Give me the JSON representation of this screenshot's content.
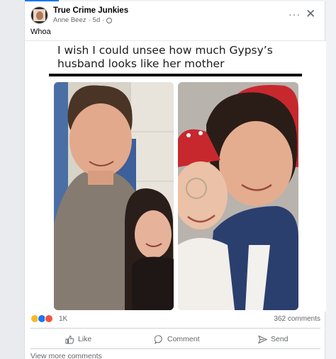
{
  "post": {
    "group_name": "True Crime Junkies",
    "author": "Anne Beez",
    "time": "5d",
    "separator": "·",
    "text": "Whoa",
    "caption": "I wish I could unsee how much Gypsy’s husband looks like her mother"
  },
  "header": {
    "more_label": "···",
    "close_label": "✕"
  },
  "footer": {
    "reaction_count": "1K",
    "comment_count": "362 comments",
    "like_label": "Like",
    "comment_label": "Comment",
    "send_label": "Send",
    "view_more": "View more comments"
  },
  "colors": {
    "accent": "#1877f2",
    "muted_text": "#65676b"
  },
  "icons": {
    "reactions": [
      "wow-icon",
      "like-icon",
      "haha-icon"
    ],
    "actions": [
      "like-icon",
      "comment-icon",
      "send-icon"
    ]
  }
}
